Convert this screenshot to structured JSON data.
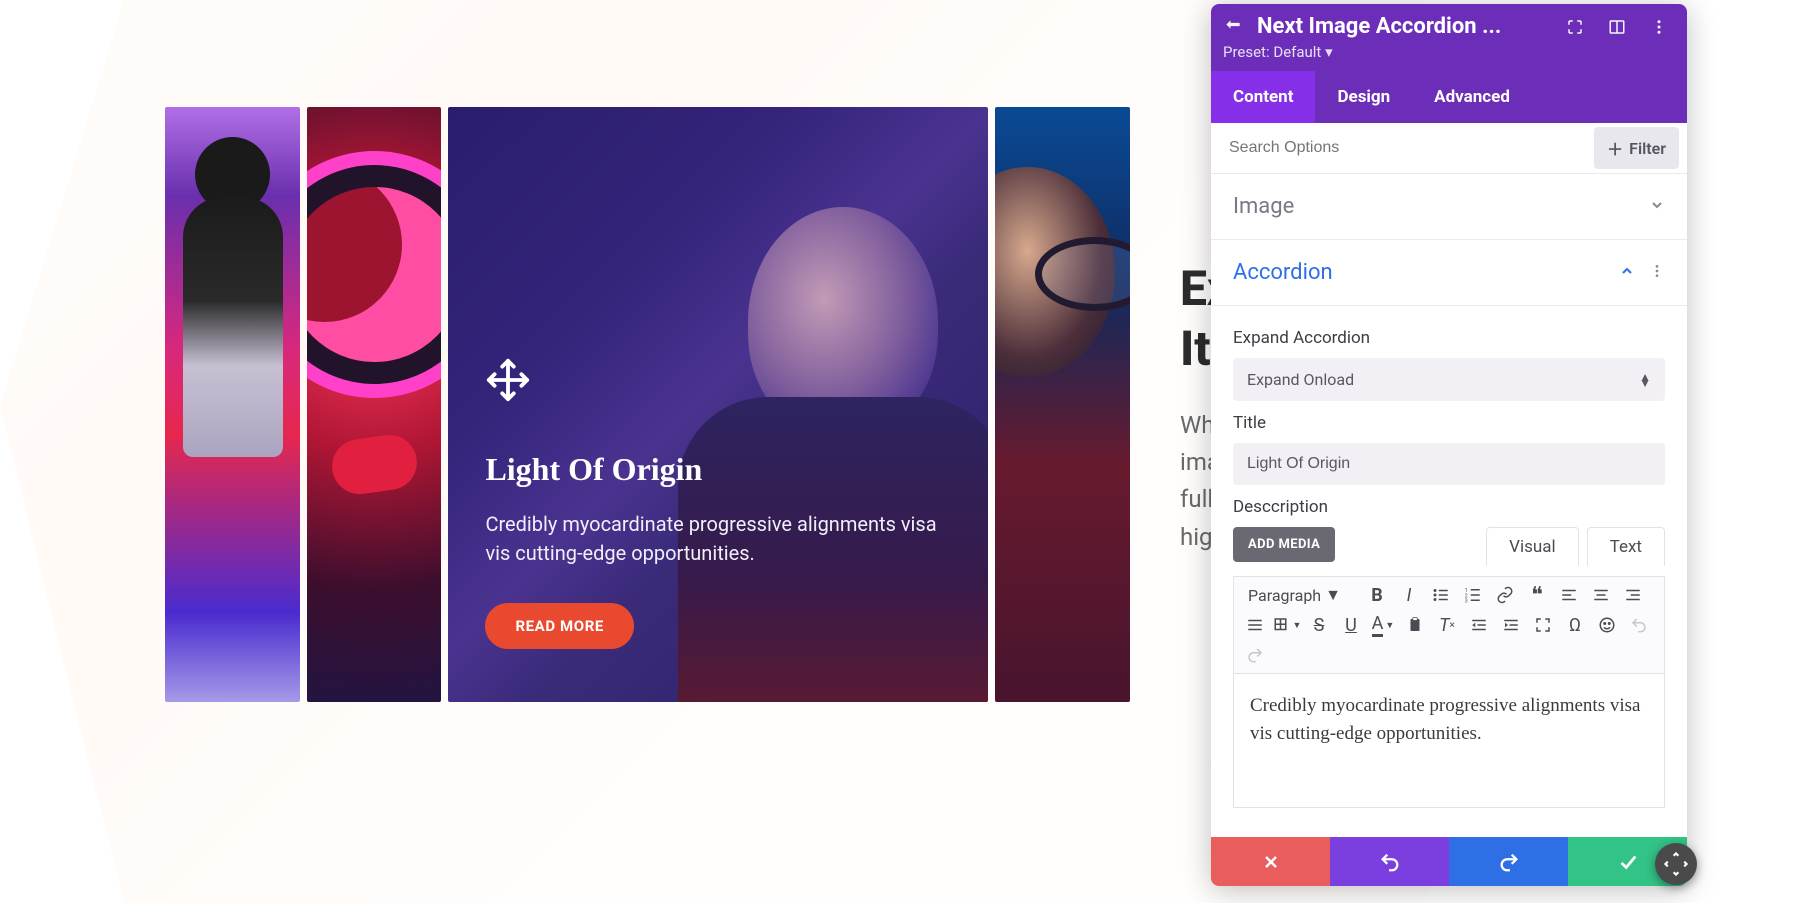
{
  "page_background": {
    "heading_line1": "Ex",
    "heading_line2": "Ite",
    "para_line1": "Wh",
    "para_line2": "ima",
    "para_line3": "full",
    "para_line4": "hig"
  },
  "accordion": {
    "active": {
      "title": "Light Of Origin",
      "desc": "Credibly myocardinate progressive alignments visa vis cutting-edge opportunities.",
      "cta": "READ MORE"
    }
  },
  "panel": {
    "header": {
      "title": "Next Image Accordion ...",
      "preset_label": "Preset:",
      "preset_value": "Default"
    },
    "tabs": [
      "Content",
      "Design",
      "Advanced"
    ],
    "active_tab": "Content",
    "search_placeholder": "Search Options",
    "filter_btn": "Filter",
    "sections": {
      "image_label": "Image",
      "accordion_label": "Accordion"
    },
    "fields": {
      "expand_label": "Expand Accordion",
      "expand_value": "Expand Onload",
      "title_label": "Title",
      "title_value": "Light Of Origin",
      "desc_label": "Desccription",
      "add_media": "ADD MEDIA",
      "editor_tabs": {
        "visual": "Visual",
        "text": "Text"
      },
      "paragraph_label": "Paragraph",
      "editor_content": "Credibly myocardinate progressive alignments visa vis cutting-edge opportunities."
    }
  }
}
